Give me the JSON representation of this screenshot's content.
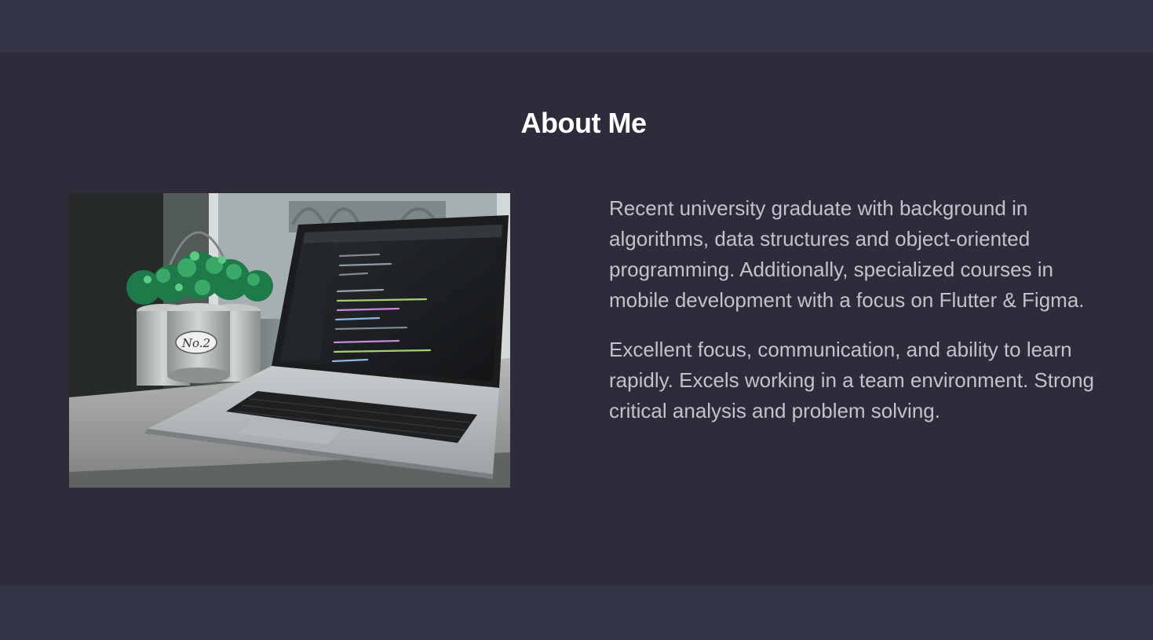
{
  "about": {
    "title": "About Me",
    "image_alt": "Laptop showing code editor beside potted plants",
    "pot_label": "No.2",
    "paragraphs": [
      "Recent university graduate with background in algorithms, data structures and object-oriented programming. Additionally, specialized courses in mobile development with a focus on Flutter & Figma.",
      "Excellent focus, communication, and ability to learn rapidly. Excels working in a team environment. Strong critical analysis and problem solving."
    ]
  },
  "colors": {
    "band": "#333547",
    "section_background": "#2e2c3a",
    "title": "#ffffff",
    "body_text": "#c3c2ca"
  }
}
